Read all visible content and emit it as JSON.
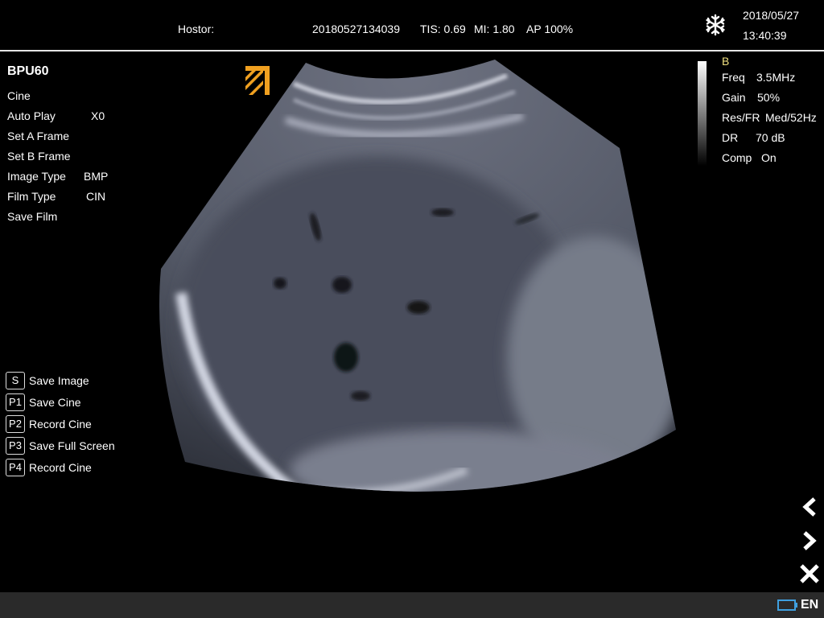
{
  "header": {
    "hostor_label": "Hostor:",
    "exam_id": "20180527134039",
    "tis": "TIS: 0.69",
    "mi": "MI: 1.80",
    "ap": "AP 100%",
    "date": "2018/05/27",
    "time": "13:40:39",
    "freeze_icon": "snowflake-icon"
  },
  "sidebar": {
    "probe": "BPU60",
    "items": [
      {
        "label": "Cine",
        "value": ""
      },
      {
        "label": "Auto Play",
        "value": "X0"
      },
      {
        "label": "Set A Frame",
        "value": ""
      },
      {
        "label": "Set B Frame",
        "value": ""
      },
      {
        "label": "Image Type",
        "value": "BMP"
      },
      {
        "label": "Film Type",
        "value": "CIN"
      },
      {
        "label": "Save Film",
        "value": ""
      }
    ]
  },
  "params": {
    "mode": "B",
    "rows": [
      {
        "label": "Freq",
        "value": "3.5MHz"
      },
      {
        "label": "Gain",
        "value": "50%"
      },
      {
        "label": "Res/FR",
        "value": "Med/52Hz"
      },
      {
        "label": "DR",
        "value": "70 dB"
      },
      {
        "label": "Comp",
        "value": "On"
      }
    ]
  },
  "shortcuts": [
    {
      "key": "S",
      "label": "Save Image"
    },
    {
      "key": "P1",
      "label": "Save Cine"
    },
    {
      "key": "P2",
      "label": "Record Cine"
    },
    {
      "key": "P3",
      "label": "Save Full Screen"
    },
    {
      "key": "P4",
      "label": "Record Cine"
    }
  ],
  "nav": {
    "prev_icon": "chevron-left-icon",
    "next_icon": "chevron-right-icon",
    "close_icon": "close-icon"
  },
  "status": {
    "language": "EN",
    "battery_icon": "battery-icon"
  },
  "colors": {
    "mode_label": "#f0e080",
    "logo": "#f0a020",
    "status_bar": "#2a2a2a",
    "battery": "#3fa0e0"
  }
}
